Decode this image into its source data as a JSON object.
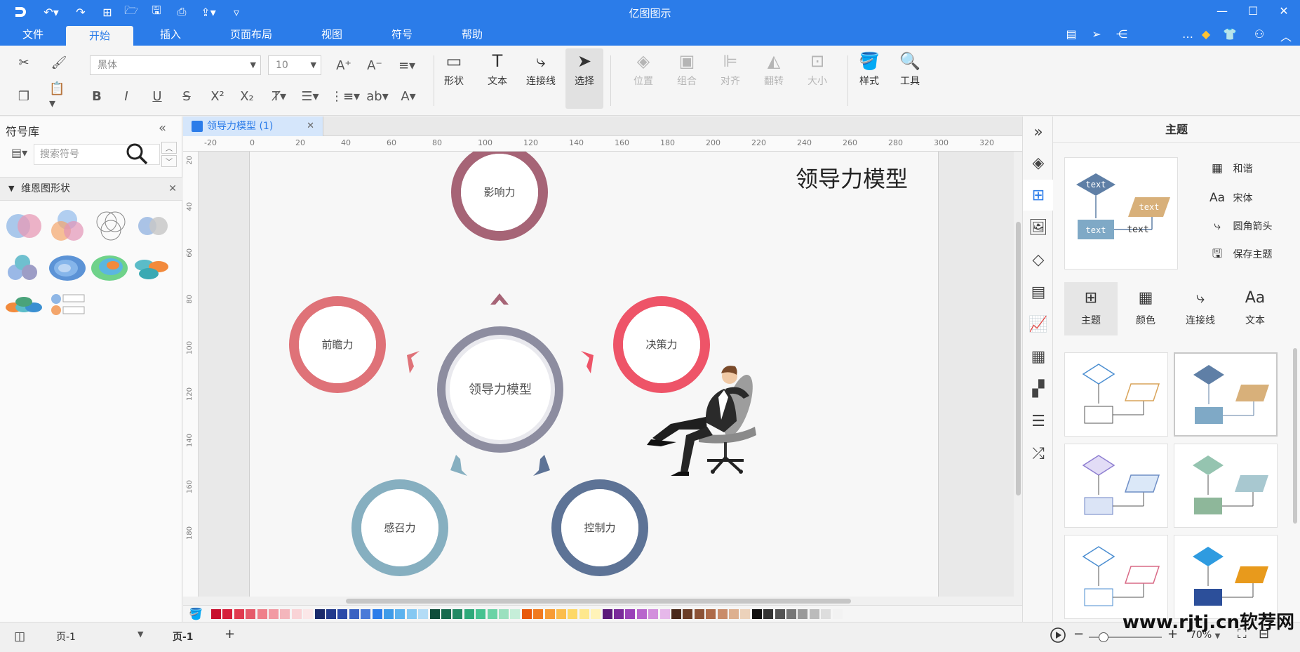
{
  "app": {
    "title": "亿图图示"
  },
  "menubar": {
    "items": [
      {
        "label": "文件"
      },
      {
        "label": "开始"
      },
      {
        "label": "插入"
      },
      {
        "label": "页面布局"
      },
      {
        "label": "视图"
      },
      {
        "label": "符号"
      },
      {
        "label": "帮助"
      }
    ],
    "active": "开始"
  },
  "ribbon": {
    "font_family": "黑体",
    "font_size": "10",
    "big_buttons": [
      {
        "label": "形状"
      },
      {
        "label": "文本"
      },
      {
        "label": "连接线"
      },
      {
        "label": "选择"
      },
      {
        "label": "位置"
      },
      {
        "label": "组合"
      },
      {
        "label": "对齐"
      },
      {
        "label": "翻转"
      },
      {
        "label": "大小"
      },
      {
        "label": "样式"
      },
      {
        "label": "工具"
      }
    ]
  },
  "left_panel": {
    "title": "符号库",
    "search_placeholder": "搜索符号",
    "section": "维恩图形状"
  },
  "document": {
    "tab_label": "领导力模型 (1)",
    "ruler_h": [
      "-20",
      "0",
      "20",
      "40",
      "60",
      "80",
      "100",
      "120",
      "140",
      "160",
      "180",
      "200",
      "220",
      "240",
      "260",
      "280",
      "300",
      "320"
    ],
    "ruler_v": [
      "20",
      "40",
      "60",
      "80",
      "100",
      "120",
      "140",
      "160",
      "180"
    ]
  },
  "diagram": {
    "title": "领导力模型",
    "center": {
      "label": "领导力模型",
      "color": "#8d8da0"
    },
    "nodes": [
      {
        "label": "影响力",
        "color": "#a66476"
      },
      {
        "label": "决策力",
        "color": "#ee5468"
      },
      {
        "label": "控制力",
        "color": "#5d7396"
      },
      {
        "label": "感召力",
        "color": "#86afc0"
      },
      {
        "label": "前瞻力",
        "color": "#df7278"
      }
    ]
  },
  "right_panel": {
    "title": "主题",
    "preview_text": [
      "text",
      "text",
      "text",
      "text"
    ],
    "options": [
      {
        "icon": "palette-icon",
        "label": "和谐"
      },
      {
        "icon": "font-icon",
        "label": "宋体"
      },
      {
        "icon": "connector-icon",
        "label": "圆角箭头"
      },
      {
        "icon": "save-icon",
        "label": "保存主题"
      }
    ],
    "tabs": [
      {
        "label": "主题"
      },
      {
        "label": "颜色"
      },
      {
        "label": "连接线"
      },
      {
        "label": "文本"
      }
    ]
  },
  "statusbar": {
    "page_select": "页-1",
    "page_tab": "页-1",
    "add": "+",
    "zoom_minus": "−",
    "zoom_plus": "+",
    "zoom": "70%",
    "zoom_fraction": 0.15
  },
  "watermark": "www.rjtj.cn软荐网"
}
